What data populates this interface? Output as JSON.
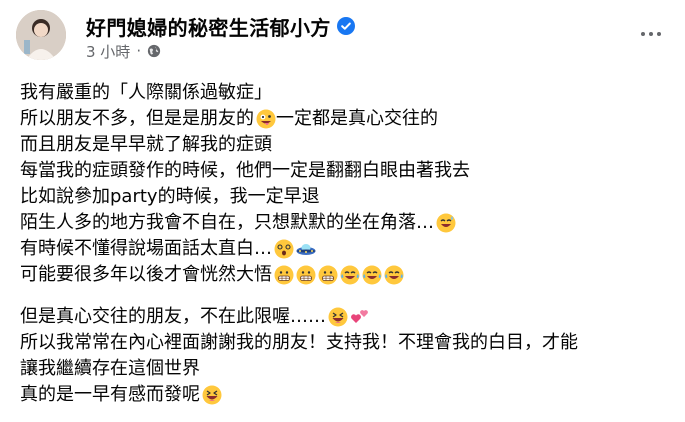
{
  "header": {
    "author_name": "好門媳婦的秘密生活郁小方",
    "timestamp": "3 小時",
    "separator": "·",
    "avatar_icon": "profile-photo",
    "verified_icon": "verified-badge-icon",
    "privacy_icon": "globe-icon",
    "more_icon": "more-options-icon",
    "verified_color": "#1877f2"
  },
  "post": {
    "lines": [
      {
        "text": "我有嚴重的「人際關係過敏症」",
        "emojis": []
      },
      {
        "text": "所以朋友不多，但是是朋友的",
        "emojis": [
          "crazy-face-icon"
        ],
        "tail": "一定都是真心交往的"
      },
      {
        "text": "而且朋友是早早就了解我的症頭",
        "emojis": []
      },
      {
        "text": "每當我的症頭發作的時候，他們一定是翻翻白眼由著我去",
        "emojis": []
      },
      {
        "text": "比如說參加party的時候，我一定早退",
        "emojis": []
      },
      {
        "text": "陌生人多的地方我會不自在，只想默默的坐在角落…",
        "emojis": [
          "sweat-smile-icon"
        ]
      },
      {
        "text": "有時候不懂得說場面話太直白…",
        "emojis": [
          "dizzy-face-icon",
          "flying-saucer-icon"
        ]
      },
      {
        "text": "可能要很多年以後才會恍然大悟",
        "emojis": [
          "grimace-icon",
          "grimace-icon",
          "grimace-icon",
          "tears-of-joy-icon",
          "tears-of-joy-icon",
          "tears-of-joy-icon"
        ]
      },
      {
        "text": "但是真心交往的朋友，不在此限喔……",
        "emojis": [
          "laughing-icon",
          "two-hearts-icon"
        ],
        "gap_before": true
      },
      {
        "text": "所以我常常在內心裡面謝謝我的朋友！支持我！不理會我的白目，才能",
        "emojis": []
      },
      {
        "text": "讓我繼續存在這個世界",
        "emojis": []
      },
      {
        "text": "真的是一早有感而發呢",
        "emojis": [
          "laughing-icon"
        ]
      }
    ]
  }
}
